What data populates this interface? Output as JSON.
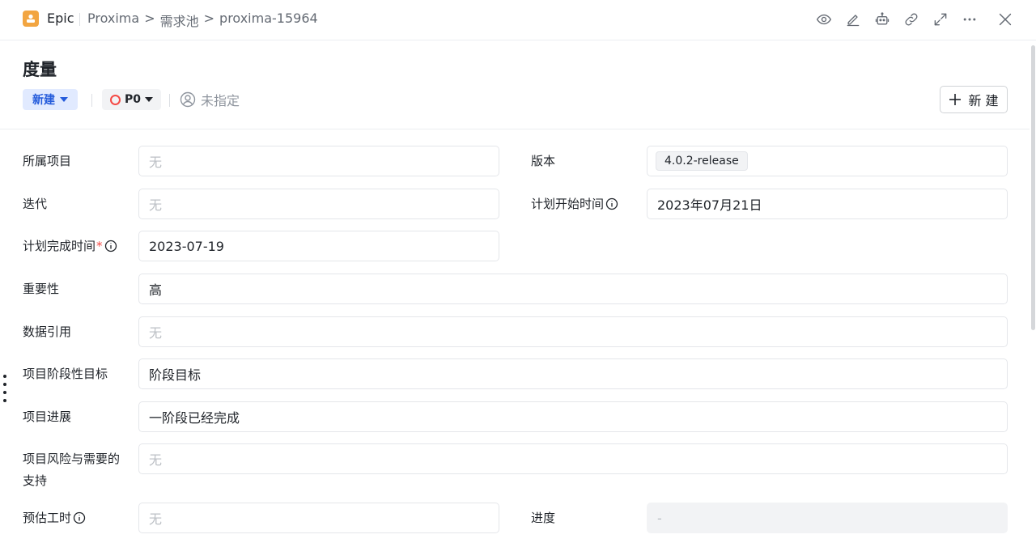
{
  "header": {
    "type_label": "Epic",
    "breadcrumb": [
      "Proxima",
      ">",
      "需求池",
      ">",
      "proxima-15964"
    ],
    "icons": [
      "eye-icon",
      "edit-icon",
      "robot-icon",
      "link-icon",
      "expand-icon",
      "more-icon",
      "close-icon"
    ]
  },
  "issue": {
    "title": "度量",
    "status": "新建",
    "priority": "P0",
    "assignee": "未指定",
    "new_button": "新 建"
  },
  "colors": {
    "type_icon": "#f2a541",
    "status_bg": "#e1eaff",
    "status_text": "#245bdb",
    "priority_ring": "#f54a45",
    "required_mark": "#f54a45"
  },
  "fields": {
    "project": {
      "label": "所属项目",
      "value": "无"
    },
    "version": {
      "label": "版本",
      "value": "4.0.2-release"
    },
    "iteration": {
      "label": "迭代",
      "value": "无"
    },
    "plan_start": {
      "label": "计划开始时间",
      "value": "2023年07月21日"
    },
    "plan_end": {
      "label": "计划完成时间",
      "required": "*",
      "value": "2023-07-19"
    },
    "importance": {
      "label": "重要性",
      "value": "高"
    },
    "data_ref": {
      "label": "数据引用",
      "value": "无"
    },
    "stage_goal": {
      "label": "项目阶段性目标",
      "value": "阶段目标"
    },
    "progress_note": {
      "label": "项目进展",
      "value": "一阶段已经完成"
    },
    "risk_line1": "项目风险与需要的",
    "risk_line2": "支持",
    "risk_value": "无",
    "estimate": {
      "label": "预估工时",
      "value": "无"
    },
    "progress": {
      "label": "进度",
      "value": "-"
    }
  }
}
